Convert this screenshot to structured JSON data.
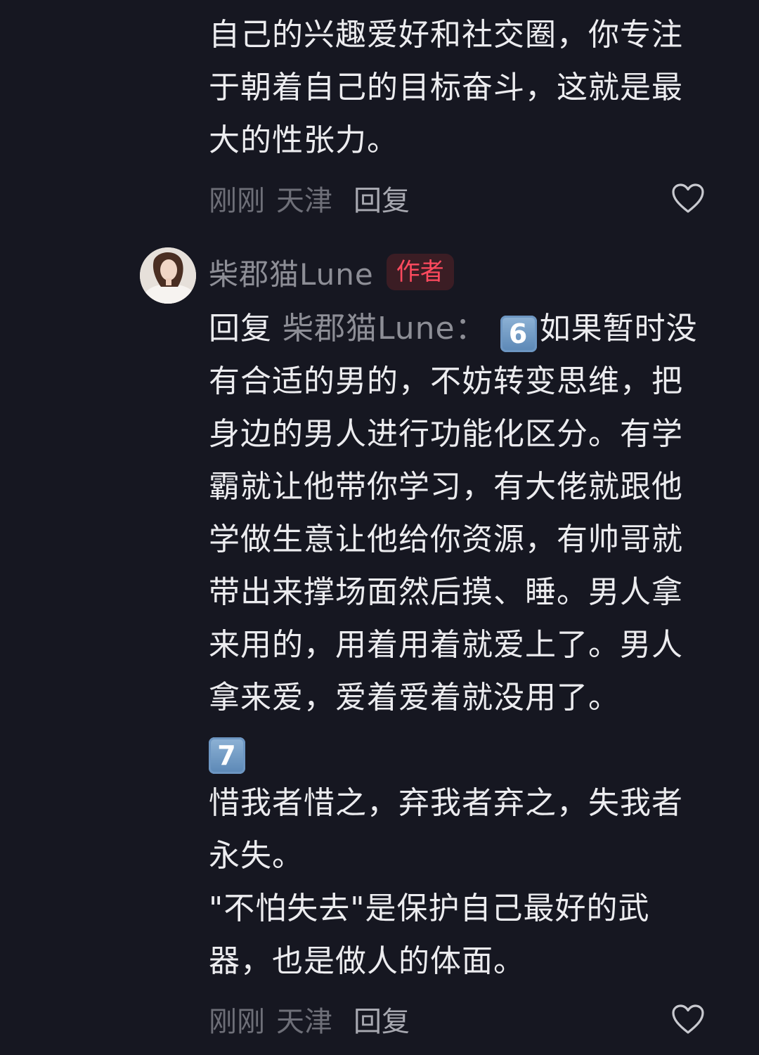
{
  "comment1": {
    "lines": [
      "自己的兴趣爱好和社交圈，你专注",
      "于朝着自己的目标奋斗，这就是最",
      "大的性张力。"
    ],
    "time": "刚刚",
    "location": "天津",
    "reply_label": "回复",
    "like_icon": "heart-outline-icon"
  },
  "comment2": {
    "username": "柴郡猫Lune",
    "author_badge": "作者",
    "reply_prefix": "回复",
    "reply_target": "柴郡猫Lune：",
    "keycap6": "6",
    "keycap7": "7",
    "first_line_rest": "如果暂时没",
    "lines": [
      "有合适的男的，不妨转变思维，把",
      "身边的男人进行功能化区分。有学",
      "霸就让他带你学习，有大佬就跟他",
      "学做生意让他给你资源，有帅哥就",
      "带出来撑场面然后摸、睡。男人拿",
      "来用的，用着用着就爱上了。男人",
      "拿来爱，爱着爱着就没用了。"
    ],
    "lines2": [
      "惜我者惜之，弃我者弃之，失我者",
      "永失。",
      "\"不怕失去\"是保护自己最好的武",
      "器，也是做人的体面。"
    ],
    "time": "刚刚",
    "location": "天津",
    "reply_label": "回复",
    "like_icon": "heart-outline-icon",
    "colors": {
      "author_badge_text": "#FF4A5E",
      "author_badge_bg": "#3B1D24"
    }
  }
}
